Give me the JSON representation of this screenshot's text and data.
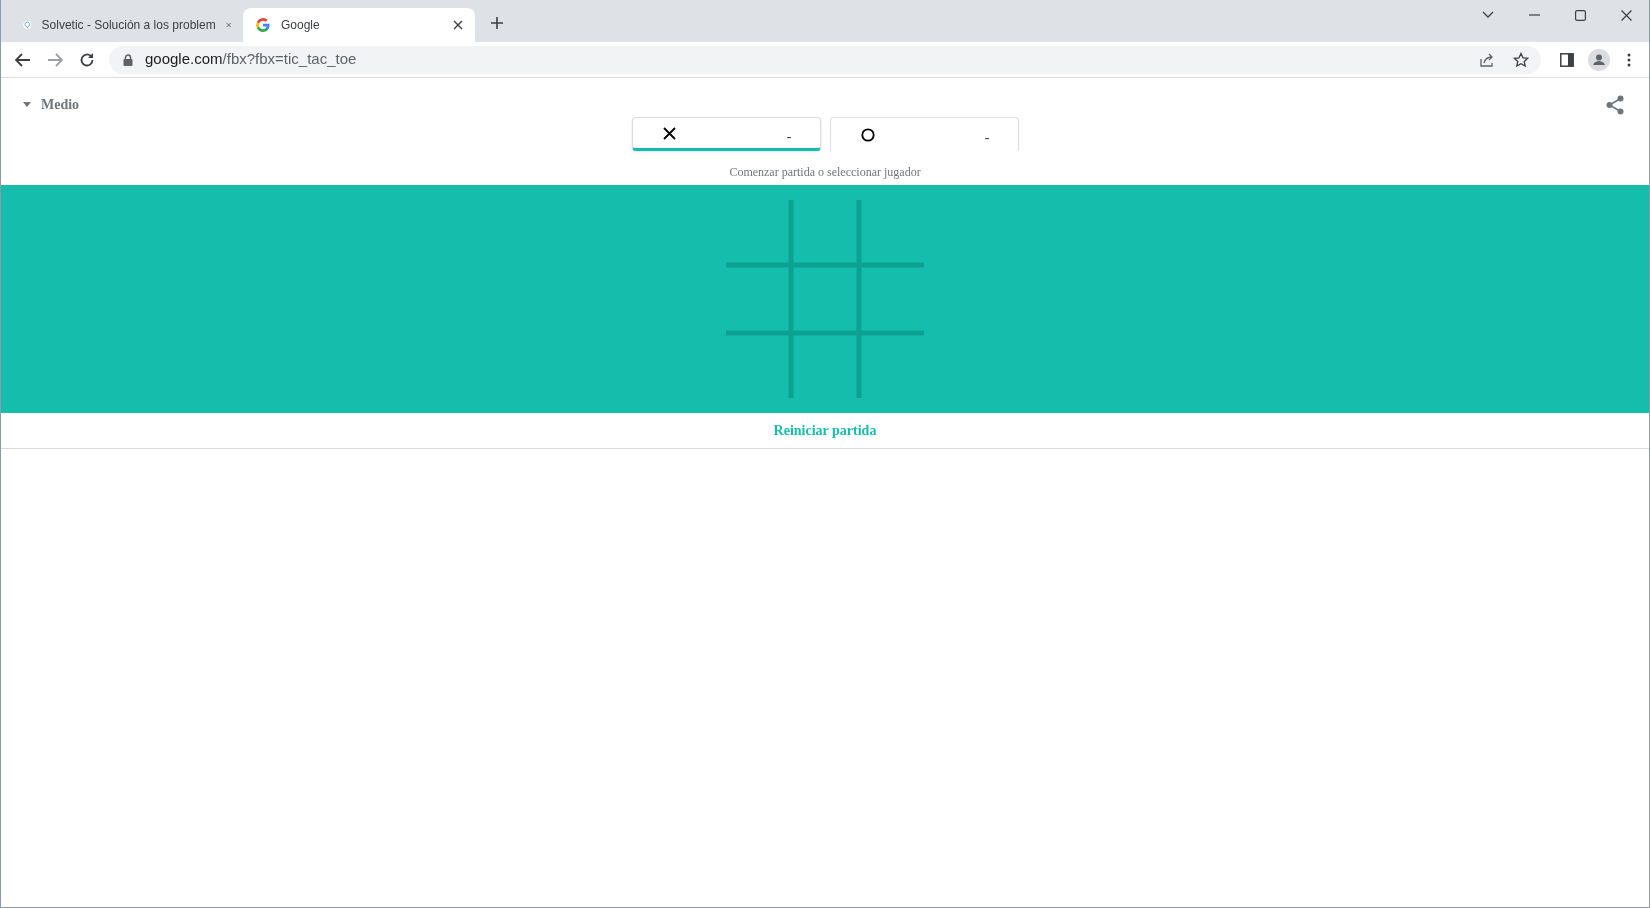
{
  "browser": {
    "tabs": [
      {
        "kind": "solvetic",
        "title": "Solvetic - Solución a los problem",
        "selected": false
      },
      {
        "kind": "google",
        "title": "Google",
        "selected": true
      }
    ],
    "url": {
      "host": "google.com",
      "path": "/fbx?fbx=tic_tac_toe"
    }
  },
  "game": {
    "difficulty": "Medio",
    "players": [
      {
        "kind": "x",
        "score": "-",
        "selected": true
      },
      {
        "kind": "o",
        "score": "-",
        "selected": false
      }
    ],
    "caption": "Comenzar partida o seleccionar jugador",
    "restart": "Reiniciar partida"
  }
}
